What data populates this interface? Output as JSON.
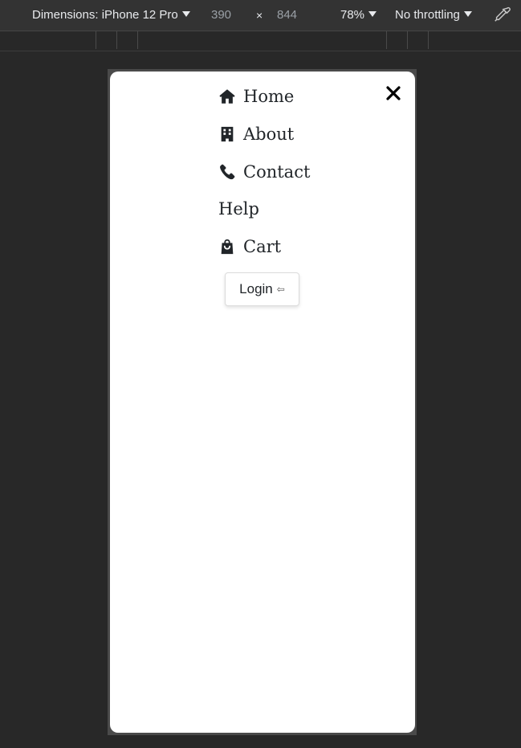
{
  "devtools": {
    "dimensions_label": "Dimensions: iPhone 12 Pro",
    "width": "390",
    "times": "×",
    "height": "844",
    "zoom": "78%",
    "throttling": "No throttling"
  },
  "menu": {
    "items": [
      {
        "label": "Home",
        "icon": "home-icon"
      },
      {
        "label": "About",
        "icon": "building-icon"
      },
      {
        "label": "Contact",
        "icon": "phone-icon"
      },
      {
        "label": "Help",
        "icon": ""
      },
      {
        "label": "Cart",
        "icon": "shopping-bag-icon"
      }
    ],
    "close_glyph": "✕",
    "login_label": "Login",
    "login_arrow": "⇦"
  },
  "colors": {
    "text": "#212529",
    "page_bg": "#282828",
    "toolbar_bg": "#333333"
  }
}
